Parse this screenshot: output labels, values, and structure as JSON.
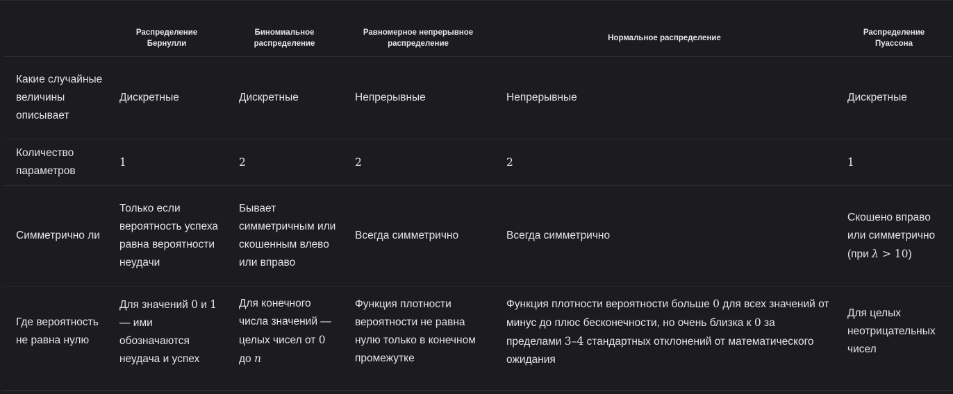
{
  "table": {
    "headers": [
      "",
      "Распределение Бернулли",
      "Биномиальное распределение",
      "Равномерное непрерывное распределение",
      "Нормальное распределение",
      "Распределение Пуассона"
    ],
    "rows": [
      {
        "label": "Какие случайные величины описывает",
        "cells": [
          "Дискретные",
          "Дискретные",
          "Непрерывные",
          "Непрерывные",
          "Дискретные"
        ]
      },
      {
        "label": "Количество параметров",
        "cells": [
          "1",
          "2",
          "2",
          "2",
          "1"
        ]
      },
      {
        "label": "Симметрично ли",
        "cells": [
          "Только если вероятность успеха равна вероятности неудачи",
          "Бывает симметричным или скошенным влево или вправо",
          "Всегда симметрично",
          "Всегда симметрично",
          "Скошено вправо или симметрично"
        ],
        "poisson_condition": {
          "prefix": "(при ",
          "symbol": "λ",
          "relation": " > 10",
          "suffix": ")"
        }
      },
      {
        "label": "Где вероятность не равна нулю",
        "bernoulli": {
          "t1": "Для значений ",
          "v1": "0",
          "t2": " и ",
          "v2": "1",
          "t3": " — ими обозначаются неудача и успех"
        },
        "binomial": {
          "t1": "Для конечного числа значений — целых чисел от ",
          "v1": "0",
          "t2": " до ",
          "v2": "n"
        },
        "uniform": "Функция плотности вероятности не равна нулю только в конечном промежутке",
        "normal": {
          "t1": "Функция плотности вероятности больше ",
          "v1": "0",
          "t2": " для всех значений от минус до плюс бесконечности, но очень близка к ",
          "v2": "0",
          "t3": " за пределами ",
          "v3": "3–4",
          "t4": " стандартных отклонений от математического ожидания"
        },
        "poisson": "Для целых неотрицательных чисел"
      }
    ]
  }
}
